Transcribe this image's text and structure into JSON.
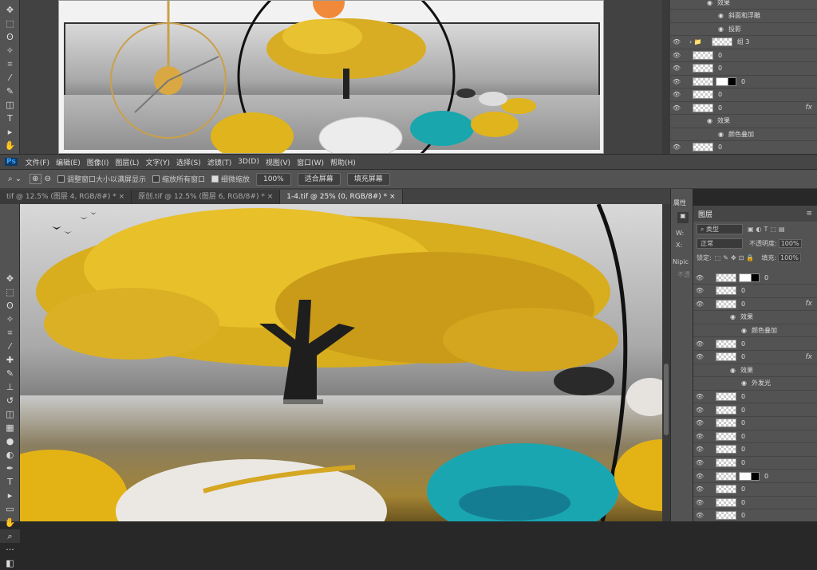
{
  "menu": [
    "文件(F)",
    "编辑(E)",
    "图像(I)",
    "图层(L)",
    "文字(Y)",
    "选择(S)",
    "滤镜(T)",
    "3D(D)",
    "视图(V)",
    "窗口(W)",
    "帮助(H)"
  ],
  "options": {
    "resize_windows": "调整窗口大小以满屏显示",
    "zoom_all": "缩放所有窗口",
    "scrubby_zoom": "细微缩放",
    "zoom_level": "100%",
    "fit_screen": "适合屏幕",
    "fill_screen": "填充屏幕"
  },
  "tabs": [
    "tif @ 12.5% (图层 4, RGB/8#) *",
    "原创.tif @ 12.5% (图层 6, RGB/8#) *",
    "1-4.tif @ 25% (0, RGB/8#) *"
  ],
  "properties": {
    "title": "属性",
    "w": "W:",
    "x": "X:",
    "nipic": "Nipic",
    "no_color": "不透"
  },
  "layers_panel": {
    "title": "图层",
    "kind": "类型",
    "blend": "正常",
    "opacity_label": "不透明度:",
    "opacity": "100%",
    "lock_label": "锁定:",
    "fill_label": "填充:",
    "fill": "100%"
  },
  "top_layers": [
    {
      "name": "效果",
      "sub": true
    },
    {
      "name": "斜面和浮雕",
      "sub": true
    },
    {
      "name": "投影",
      "sub": true
    },
    {
      "name": "组 3",
      "group": true
    },
    {
      "name": "0"
    },
    {
      "name": "0"
    },
    {
      "name": "0",
      "mask": true
    },
    {
      "name": "0"
    },
    {
      "name": "0",
      "fx": true
    },
    {
      "name": "效果",
      "sub": true
    },
    {
      "name": "颜色叠加",
      "sub": true
    },
    {
      "name": "0"
    },
    {
      "name": "0",
      "fx": true
    }
  ],
  "bottom_layers": [
    {
      "name": "0",
      "mask": true
    },
    {
      "name": "0"
    },
    {
      "name": "0",
      "fx": true
    },
    {
      "name": "效果",
      "sub": true
    },
    {
      "name": "颜色叠加",
      "sub": true
    },
    {
      "name": "0"
    },
    {
      "name": "0",
      "fx": true
    },
    {
      "name": "效果",
      "sub": true
    },
    {
      "name": "外发光",
      "sub": true
    },
    {
      "name": "0"
    },
    {
      "name": "0"
    },
    {
      "name": "0"
    },
    {
      "name": "0"
    },
    {
      "name": "0"
    },
    {
      "name": "0"
    },
    {
      "name": "0",
      "mask": true
    },
    {
      "name": "0"
    },
    {
      "name": "0"
    },
    {
      "name": "0"
    }
  ]
}
